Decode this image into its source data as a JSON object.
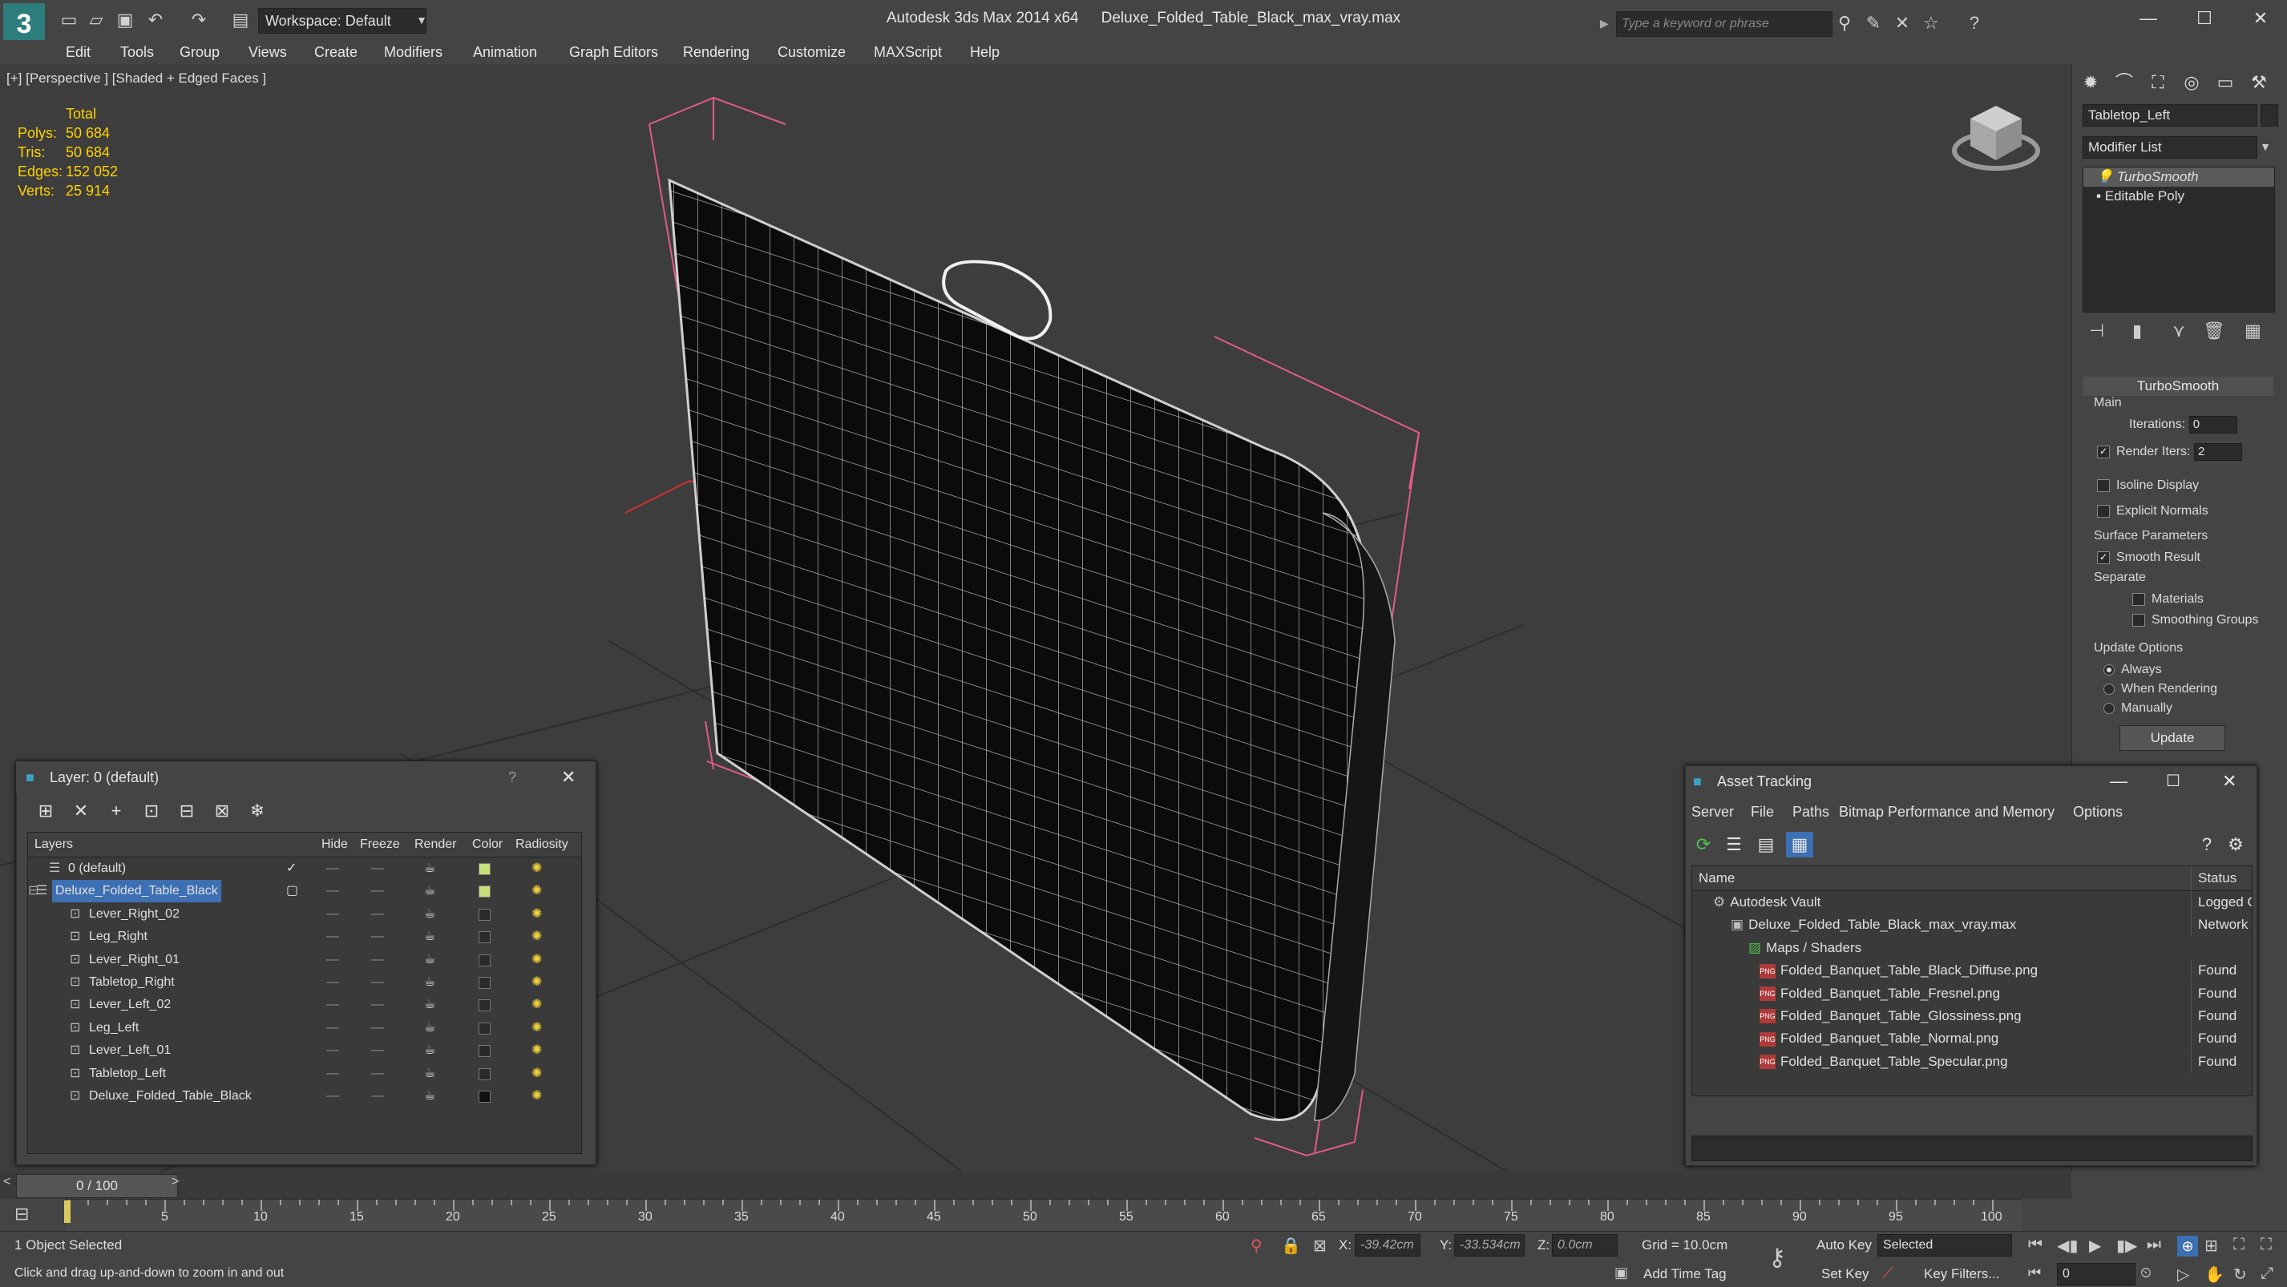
{
  "titlebar": {
    "workspace": "Workspace: Default",
    "app_name": "Autodesk 3ds Max  2014 x64",
    "file_name": "Deluxe_Folded_Table_Black_max_vray.max",
    "search_placeholder": "Type a keyword or phrase"
  },
  "menu": [
    "Edit",
    "Tools",
    "Group",
    "Views",
    "Create",
    "Modifiers",
    "Animation",
    "Graph Editors",
    "Rendering",
    "Customize",
    "MAXScript",
    "Help"
  ],
  "viewport": {
    "label": "[+] [Perspective ] [Shaded + Edged Faces ]",
    "stats_header": "Total",
    "stats": [
      {
        "k": "Polys:",
        "v": "50 684"
      },
      {
        "k": "Tris:",
        "v": "50 684"
      },
      {
        "k": "Edges:",
        "v": "152 052"
      },
      {
        "k": "Verts:",
        "v": "25 914"
      }
    ]
  },
  "command_panel": {
    "object_name": "Tabletop_Left",
    "modifier_list": "Modifier List",
    "stack": [
      "TurboSmooth",
      "Editable Poly"
    ],
    "rollout": "TurboSmooth",
    "main_label": "Main",
    "iterations_label": "Iterations:",
    "iterations_value": "0",
    "render_iters_label": "Render Iters:",
    "render_iters_value": "2",
    "isoline_display": "Isoline Display",
    "explicit_normals": "Explicit Normals",
    "surface_params": "Surface Parameters",
    "smooth_result": "Smooth Result",
    "separate": "Separate",
    "materials": "Materials",
    "smoothing_groups": "Smoothing Groups",
    "update_options": "Update Options",
    "always": "Always",
    "when_rendering": "When Rendering",
    "manually": "Manually",
    "update_button": "Update"
  },
  "layer_dialog": {
    "title": "Layer: 0 (default)",
    "help": "?",
    "columns": [
      "Layers",
      "Hide",
      "Freeze",
      "Render",
      "Color",
      "Radiosity"
    ],
    "rows": [
      {
        "name": "0 (default)",
        "color": "#c8e07a"
      },
      {
        "name": "Deluxe_Folded_Table_Black",
        "color": "#c8e07a"
      },
      {
        "name": "Lever_Right_02",
        "color": "#2a2a2a"
      },
      {
        "name": "Leg_Right",
        "color": "#2a2a2a"
      },
      {
        "name": "Lever_Right_01",
        "color": "#2a2a2a"
      },
      {
        "name": "Tabletop_Right",
        "color": "#2a2a2a"
      },
      {
        "name": "Lever_Left_02",
        "color": "#2a2a2a"
      },
      {
        "name": "Leg_Left",
        "color": "#2a2a2a"
      },
      {
        "name": "Lever_Left_01",
        "color": "#2a2a2a"
      },
      {
        "name": "Tabletop_Left",
        "color": "#2a2a2a"
      },
      {
        "name": "Deluxe_Folded_Table_Black",
        "color": "#111111"
      }
    ]
  },
  "asset_dialog": {
    "title": "Asset Tracking",
    "menu": [
      "Server",
      "File",
      "Paths",
      "Bitmap Performance and Memory",
      "Options"
    ],
    "col_name": "Name",
    "col_status": "Status",
    "rows": [
      {
        "name": "Autodesk Vault",
        "status": "Logged C"
      },
      {
        "name": "Deluxe_Folded_Table_Black_max_vray.max",
        "status": "Network I"
      },
      {
        "name": "Maps / Shaders",
        "status": ""
      },
      {
        "name": "Folded_Banquet_Table_Black_Diffuse.png",
        "status": "Found"
      },
      {
        "name": "Folded_Banquet_Table_Fresnel.png",
        "status": "Found"
      },
      {
        "name": "Folded_Banquet_Table_Glossiness.png",
        "status": "Found"
      },
      {
        "name": "Folded_Banquet_Table_Normal.png",
        "status": "Found"
      },
      {
        "name": "Folded_Banquet_Table_Specular.png",
        "status": "Found"
      }
    ]
  },
  "timeline": {
    "frame": "0 / 100",
    "ticks": [
      "5",
      "10",
      "15",
      "20",
      "25",
      "30",
      "35",
      "40",
      "45",
      "50",
      "55",
      "60",
      "65",
      "70",
      "75",
      "80",
      "85",
      "90",
      "95",
      "100"
    ]
  },
  "status": {
    "selection": "1 Object Selected",
    "prompt": "Click and drag up-and-down to zoom in and out",
    "x_label": "X:",
    "x_value": "-39.42cm",
    "y_label": "Y:",
    "y_value": "-33.534cm",
    "z_label": "Z:",
    "z_value": "0.0cm",
    "grid": "Grid = 10.0cm",
    "auto_key": "Auto Key",
    "set_key": "Set Key",
    "selected": "Selected",
    "key_filters": "Key Filters...",
    "add_time_tag": "Add Time Tag",
    "frame_field": "0"
  }
}
